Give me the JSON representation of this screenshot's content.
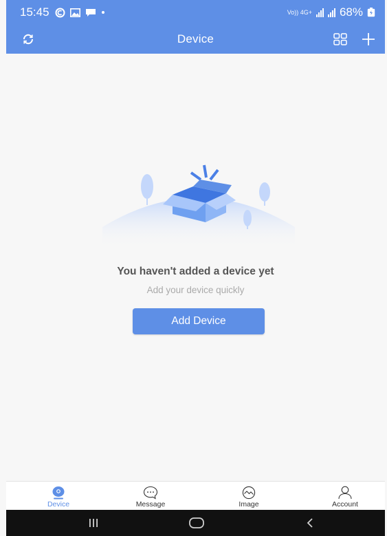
{
  "status_bar": {
    "time": "15:45",
    "network_label": "Vo)) 4G+",
    "battery": "68%"
  },
  "header": {
    "title": "Device"
  },
  "empty_state": {
    "title": "You haven't added a device yet",
    "subtitle": "Add your device quickly",
    "button_label": "Add Device"
  },
  "tabs": [
    {
      "label": "Device",
      "icon": "device-icon",
      "active": true
    },
    {
      "label": "Message",
      "icon": "message-icon",
      "active": false
    },
    {
      "label": "Image",
      "icon": "image-icon",
      "active": false
    },
    {
      "label": "Account",
      "icon": "account-icon",
      "active": false
    }
  ],
  "colors": {
    "accent": "#5e8fe6",
    "background": "#f7f7f7",
    "nav_bar": "#111111"
  }
}
